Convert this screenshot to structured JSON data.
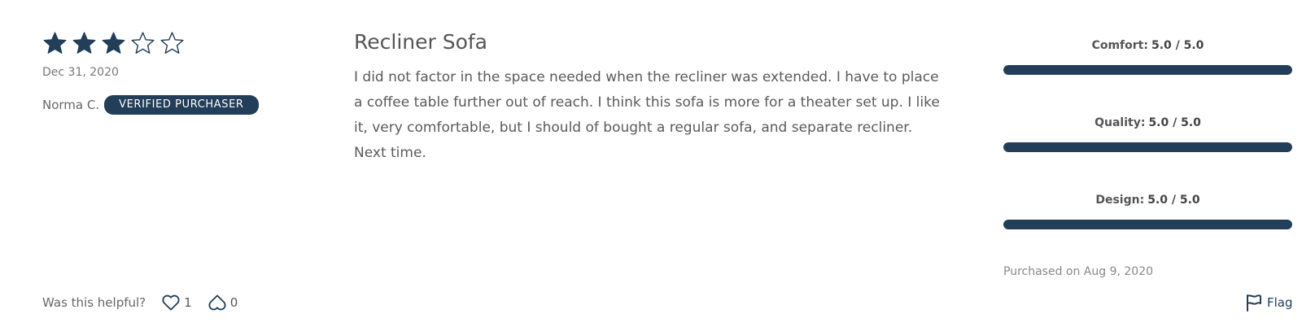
{
  "review": {
    "rating": 3,
    "rating_max": 5,
    "date": "Dec 31, 2020",
    "reviewer": "Norma C.",
    "badge": "VERIFIED PURCHASER",
    "title": "Recliner Sofa",
    "body": "I did not factor in the space needed when the recliner was extended. I have to place a coffee table further out of reach. I think this sofa is more for a theater set up. I like it, very comfortable, but I should of bought a regular sofa, and separate recliner. Next time."
  },
  "ratings": [
    {
      "label": "Comfort:",
      "value_text": "5.0 / 5.0",
      "fraction": 1.0
    },
    {
      "label": "Quality:",
      "value_text": "5.0 / 5.0",
      "fraction": 1.0
    },
    {
      "label": "Design:",
      "value_text": "5.0 / 5.0",
      "fraction": 1.0
    }
  ],
  "purchased": "Purchased on Aug 9, 2020",
  "helpful": {
    "question": "Was this helpful?",
    "up_count": "1",
    "down_count": "0",
    "up_icon": "heart-icon",
    "down_icon": "heart-down-icon"
  },
  "flag": {
    "label": "Flag",
    "icon": "flag-icon"
  },
  "colors": {
    "accent": "#223e58",
    "text": "#555555",
    "muted": "#888888"
  }
}
